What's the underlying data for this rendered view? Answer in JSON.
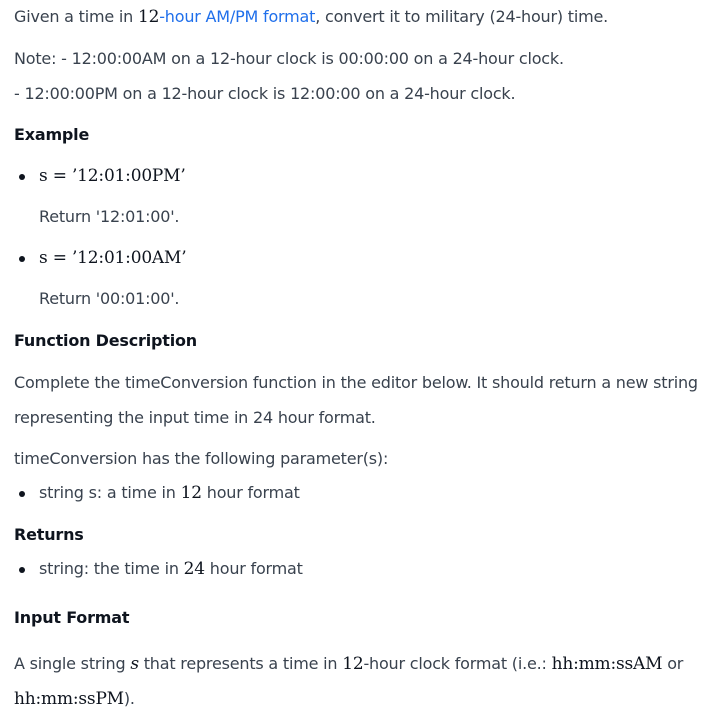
{
  "intro": {
    "prefix": "Given a time in ",
    "math12": "12",
    "link": "-hour AM/PM format",
    "suffix": ", convert it to military (24-hour) time."
  },
  "note": {
    "line1": "Note: - 12:00:00AM on a 12-hour clock is 00:00:00 on a 24-hour clock.",
    "line2": "- 12:00:00PM on a 12-hour clock is 12:00:00 on a 24-hour clock."
  },
  "example": {
    "heading": "Example",
    "items": [
      {
        "math": "s = ’12:01:00PM’",
        "result": "Return '12:01:00'."
      },
      {
        "math": "s = ’12:01:00AM’",
        "result": "Return '00:01:00'."
      }
    ]
  },
  "function_description": {
    "heading": "Function Description",
    "line1": "Complete the timeConversion function in the editor below. It should return a new string",
    "line2": "representing the input time in 24 hour format.",
    "params_intro": "timeConversion has the following parameter(s):",
    "param": {
      "prefix": "string s: a time in ",
      "math": "12",
      "suffix": " hour format"
    }
  },
  "returns": {
    "heading": "Returns",
    "item": {
      "prefix": "string: the time in ",
      "math": "24",
      "suffix": " hour format"
    }
  },
  "input_format": {
    "heading": "Input Format",
    "line1_prefix": "A single string ",
    "line1_var": "s",
    "line1_mid": " that represents a time in ",
    "line1_math12": "12",
    "line1_mid2": "-hour clock format (i.e.: ",
    "line1_fmt": "hh:mm:ssAM",
    "line1_or": " or",
    "line2_fmt": "hh:mm:ssPM",
    "line2_suffix": ")."
  }
}
